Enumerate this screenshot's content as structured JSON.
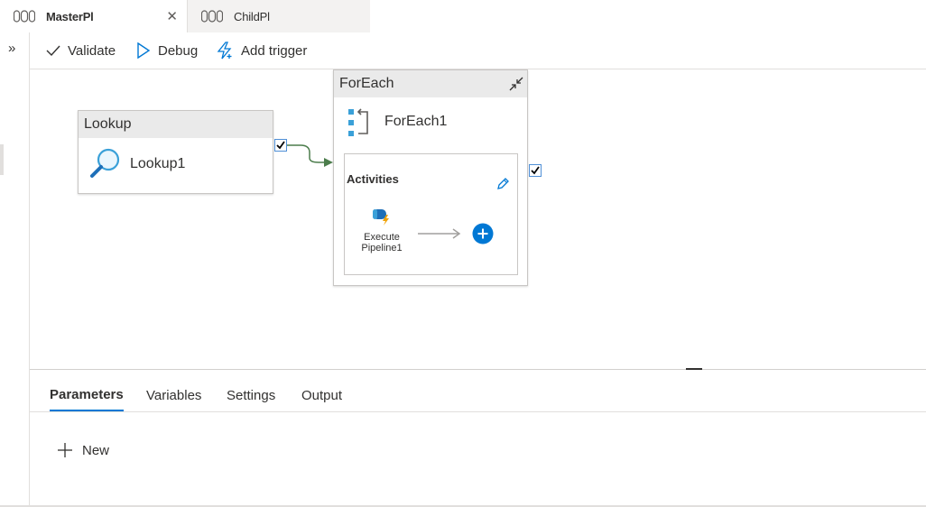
{
  "tabs": [
    {
      "label": "MasterPl",
      "active": true,
      "icon": "pipeline-icon"
    },
    {
      "label": "ChildPl",
      "active": false,
      "icon": "pipeline-icon"
    }
  ],
  "tab_close_glyph": "✕",
  "rail": {
    "expand_glyph": "»"
  },
  "toolbar": {
    "validate": "Validate",
    "debug": "Debug",
    "add_trigger": "Add trigger"
  },
  "canvas": {
    "lookup": {
      "type": "Lookup",
      "name": "Lookup1",
      "icon": "search-icon"
    },
    "foreach": {
      "type": "ForEach",
      "name": "ForEach1",
      "icon": "foreach-icon",
      "activities_label": "Activities",
      "inner_activity": {
        "line1": "Execute",
        "line2": "Pipeline1",
        "icon": "execute-pipeline-icon"
      }
    }
  },
  "bottom_panel": {
    "tabs": [
      "Parameters",
      "Variables",
      "Settings",
      "Output"
    ],
    "active_tab": "Parameters",
    "new_label": "New"
  },
  "colors": {
    "accent": "#0078d4",
    "success_arrow": "#4c7d4c",
    "header_gray": "#eaeaea"
  }
}
